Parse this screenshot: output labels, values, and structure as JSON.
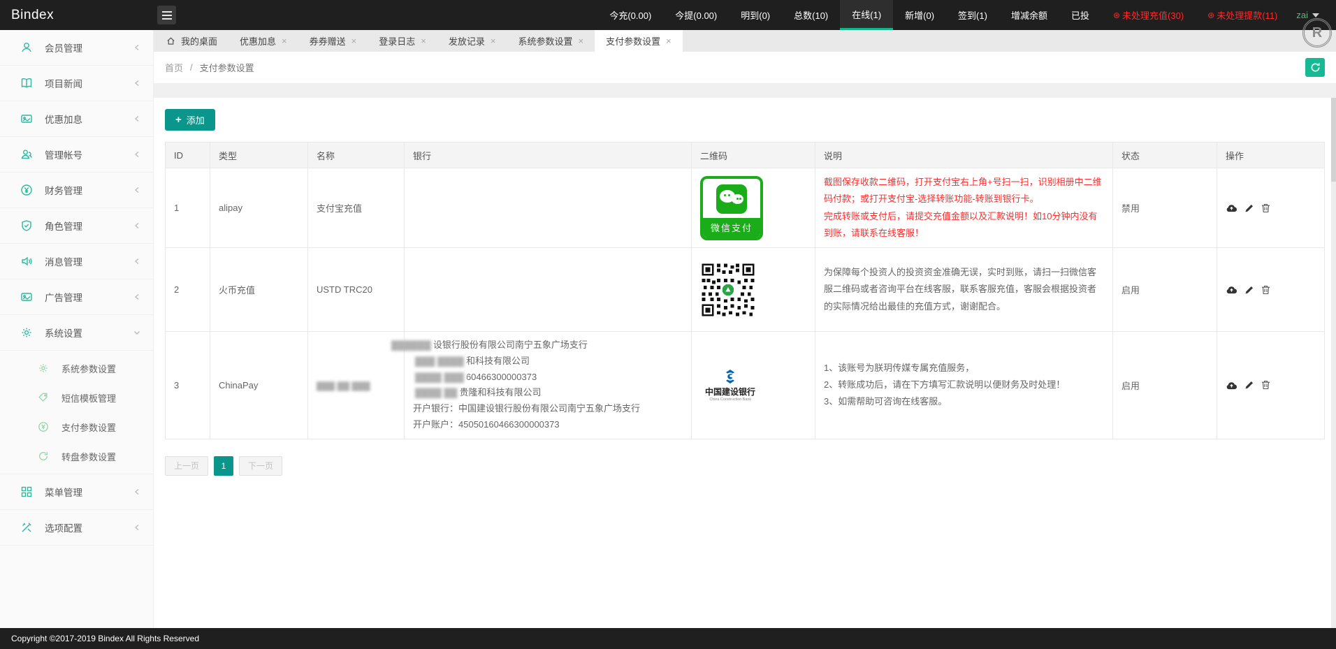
{
  "colors": {
    "accent": "#0a968b",
    "green": "#15b993",
    "wechat_green": "#1aad19",
    "alert_red": "#ff2d2d",
    "header_dark": "#1f1f1f",
    "ccb_blue": "#0066b3"
  },
  "header": {
    "logo": "Bindex",
    "stats": [
      {
        "label": "今充(0.00)"
      },
      {
        "label": "今提(0.00)"
      },
      {
        "label": "明到(0)"
      },
      {
        "label": "总数(10)"
      },
      {
        "label": "在线(1)"
      },
      {
        "label": "新增(0)"
      },
      {
        "label": "签到(1)"
      },
      {
        "label": "增减余额"
      },
      {
        "label": "已投"
      },
      {
        "label": "未处理充值(30)"
      },
      {
        "label": "未处理提款(11)"
      }
    ],
    "user": "zai",
    "r_badge": "R"
  },
  "icons": {
    "plus": "+",
    "close": "×",
    "alert_dot": "⊛"
  },
  "sidebar": {
    "top": [
      {
        "label": "会员管理"
      },
      {
        "label": "项目新闻"
      },
      {
        "label": "优惠加息"
      },
      {
        "label": "管理帐号"
      },
      {
        "label": "财务管理"
      },
      {
        "label": "角色管理"
      },
      {
        "label": "消息管理"
      },
      {
        "label": "广告管理"
      }
    ],
    "system": {
      "label": "系统设置",
      "children": [
        {
          "label": "系统参数设置"
        },
        {
          "label": "短信模板管理"
        },
        {
          "label": "支付参数设置"
        },
        {
          "label": "转盘参数设置"
        }
      ]
    },
    "bottom": [
      {
        "label": "菜单管理"
      },
      {
        "label": "选项配置"
      }
    ]
  },
  "tabs": {
    "home": "我的桌面",
    "items": [
      {
        "label": "优惠加息"
      },
      {
        "label": "券券赠送"
      },
      {
        "label": "登录日志"
      },
      {
        "label": "发放记录"
      },
      {
        "label": "系统参数设置"
      }
    ],
    "active": "支付参数设置"
  },
  "breadcrumb": {
    "home": "首页",
    "sep": "/",
    "current": "支付参数设置"
  },
  "toolbar": {
    "add_label": "添加"
  },
  "table": {
    "columns": [
      "ID",
      "类型",
      "名称",
      "银行",
      "二维码",
      "说明",
      "状态",
      "操作"
    ],
    "rows": [
      {
        "id": "1",
        "type": "alipay",
        "name": "支付宝充值",
        "qr_label": "微信支付",
        "desc": [
          "截图保存收款二维码，打开支付宝右上角+号扫一扫，识别相册中二维码付款；或打开支付宝-选择转账功能-转账到银行卡。",
          "完成转账或支付后，请提交充值金额以及汇款说明！如10分钟内没有到账，请联系在线客服！"
        ],
        "status": "禁用"
      },
      {
        "id": "2",
        "type": "火币充值",
        "name": "USTD TRC20",
        "desc": [
          "为保障每个投资人的投资资金准确无误，实时到账，请扫一扫微信客服二维码或者咨询平台在线客服，联系客服充值，客服会根据投资者的实际情况给出最佳的充值方式，谢谢配合。"
        ],
        "status": "启用"
      },
      {
        "id": "3",
        "type": "ChinaPay",
        "name_blurred": "▓▓▓ ▓▓ ▓▓▓",
        "bank": [
          {
            "blur": "▓▓▓▓▓▓",
            "text": "设银行股份有限公司南宁五象广场支行"
          },
          {
            "blur": "▓▓▓ ▓▓▓▓",
            "text": "和科技有限公司"
          },
          {
            "blur": "▓▓▓▓ ▓▓▓",
            "text": "60466300000373"
          },
          {
            "blur": "▓▓▓▓ ▓▓",
            "text": "贵隆和科技有限公司"
          },
          {
            "blur": "",
            "text": "开户银行：中国建设银行股份有限公司南宁五象广场支行"
          },
          {
            "blur": "",
            "text": "开户账户：45050160466300000373"
          }
        ],
        "qr_cn": "中国建设银行",
        "qr_en": "China Construction Bank",
        "desc": [
          "1、该账号为朕玥传媒专属充值服务，",
          "2、转账成功后，请在下方填写汇款说明以便财务及时处理！",
          "3、如需帮助可咨询在线客服。"
        ],
        "status": "启用"
      }
    ]
  },
  "pagination": {
    "prev": "上一页",
    "current": "1",
    "next": "下一页"
  },
  "footer": {
    "copyright": "Copyright ©2017-2019 Bindex All Rights Reserved"
  }
}
